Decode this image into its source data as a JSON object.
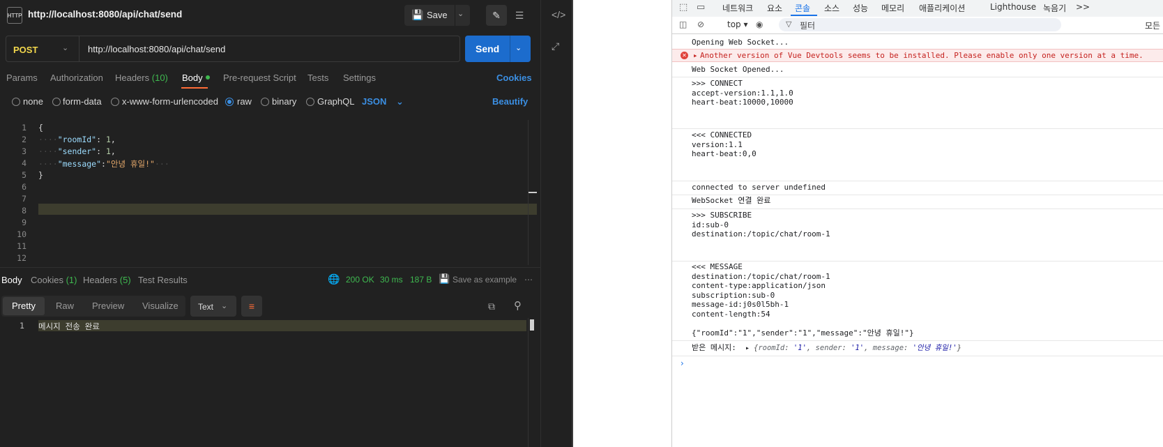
{
  "postman": {
    "request_title": "http://localhost:8080/api/chat/send",
    "http_icon_text": "HTTP",
    "save_label": "Save",
    "method": "POST",
    "url": "http://localhost:8080/api/chat/send",
    "send_label": "Send",
    "tabs": {
      "params": "Params",
      "authorization": "Authorization",
      "headers": "Headers",
      "headers_count": "(10)",
      "body": "Body",
      "prerequest": "Pre-request Script",
      "tests": "Tests",
      "settings": "Settings"
    },
    "cookies_link": "Cookies",
    "body_types": {
      "none": "none",
      "form_data": "form-data",
      "urlencoded": "x-www-form-urlencoded",
      "raw": "raw",
      "binary": "binary",
      "graphql": "GraphQL"
    },
    "body_language": "JSON",
    "beautify": "Beautify",
    "editor": {
      "line_numbers": [
        "1",
        "2",
        "3",
        "4",
        "5",
        "6",
        "7",
        "8",
        "9",
        "10",
        "11",
        "12"
      ],
      "open_brace": "{",
      "close_brace": "}",
      "key_roomId": "\"roomId\"",
      "val_roomId": "1",
      "key_sender": "\"sender\"",
      "val_sender": "1",
      "key_message": "\"message\"",
      "val_message": "\"안녕 휴일!\""
    },
    "response": {
      "tabs": {
        "body": "Body",
        "cookies": "Cookies",
        "cookies_count": "(1)",
        "headers": "Headers",
        "headers_count": "(5)",
        "test_results": "Test Results"
      },
      "status": "200 OK",
      "time": "30 ms",
      "size": "187 B",
      "save_example": "Save as example",
      "format_options": {
        "pretty": "Pretty",
        "raw": "Raw",
        "preview": "Preview",
        "visualize": "Visualize"
      },
      "text_type": "Text",
      "line_number": "1",
      "body_text": "메시지 전송 완료"
    }
  },
  "devtools": {
    "tabs": {
      "network": "네트워크",
      "elements": "요소",
      "console": "콘솔",
      "sources": "소스",
      "performance": "성능",
      "memory": "메모리",
      "application": "애플리케이션",
      "lighthouse": "Lighthouse",
      "recorder": "녹음기",
      "more": ">>"
    },
    "context": "top",
    "filter_placeholder": "필터",
    "levels": "모든 수",
    "console": {
      "l1": "Opening Web Socket...",
      "err": "Another version of Vue Devtools seems to be installed. Please enable only one version at a time.",
      "l2": "Web Socket Opened...",
      "connect": ">>> CONNECT\naccept-version:1.1,1.0\nheart-beat:10000,10000",
      "connected": "<<< CONNECTED\nversion:1.1\nheart-beat:0,0",
      "l3": "connected to server undefined",
      "l4": "WebSocket 연결 완료",
      "subscribe": ">>> SUBSCRIBE\nid:sub-0\ndestination:/topic/chat/room-1",
      "message": "<<< MESSAGE\ndestination:/topic/chat/room-1\ncontent-type:application/json\nsubscription:sub-0\nmessage-id:j0s0l5bh-1\ncontent-length:54",
      "payload": "{\"roomId\":\"1\",\"sender\":\"1\",\"message\":\"안녕 휴일!\"}",
      "received_label": "받은 메시지:",
      "obj_k1": "roomId",
      "obj_v1": "'1'",
      "obj_k2": "sender",
      "obj_v2": "'1'",
      "obj_k3": "message",
      "obj_v3": "'안녕 휴일!'"
    }
  }
}
